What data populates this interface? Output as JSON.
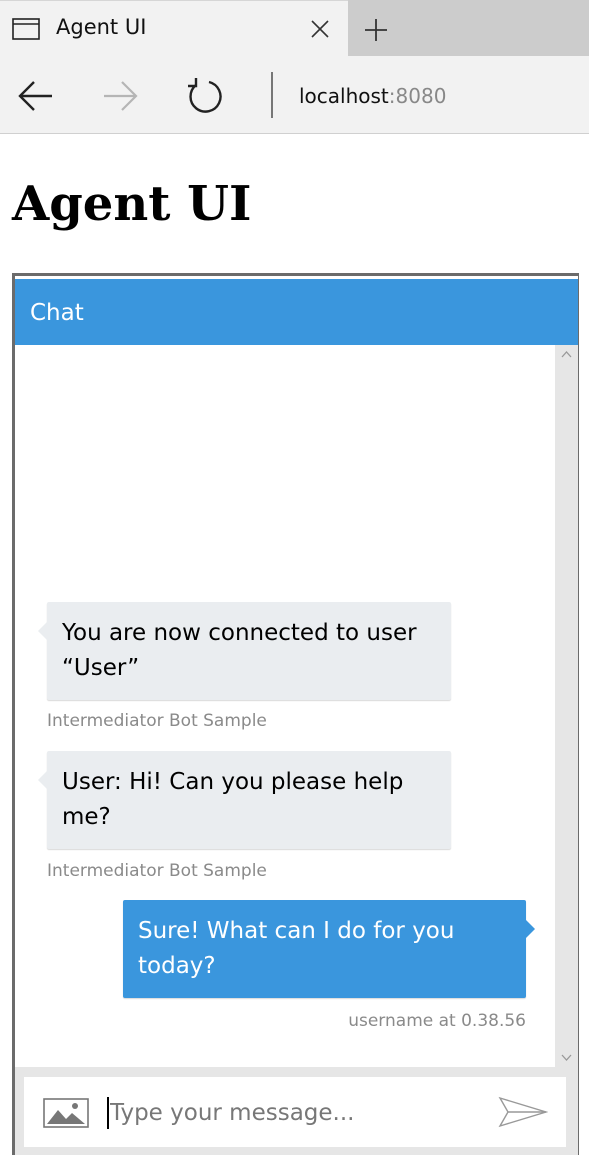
{
  "browser": {
    "tab_title": "Agent UI",
    "url_host": "localhost",
    "url_port": ":8080"
  },
  "page": {
    "title": "Agent UI"
  },
  "chat": {
    "header_title": "Chat",
    "messages": [
      {
        "direction": "incoming",
        "text": "You are now connected to user “User”",
        "meta": "Intermediator Bot Sample"
      },
      {
        "direction": "incoming",
        "text": "User: Hi! Can you please help me?",
        "meta": "Intermediator Bot Sample"
      },
      {
        "direction": "outgoing",
        "text": "Sure! What can I do for you today?",
        "meta": "username at 0.38.56"
      }
    ],
    "input_placeholder": "Type your message..."
  },
  "icons": {
    "tab": "window-icon",
    "close": "close-icon",
    "new_tab": "plus-icon",
    "back": "arrow-left-icon",
    "forward": "arrow-right-icon",
    "refresh": "refresh-icon",
    "upload": "image-icon",
    "send": "send-icon"
  },
  "colors": {
    "accent": "#3a96dd",
    "incoming_bubble": "#eaedf0"
  }
}
